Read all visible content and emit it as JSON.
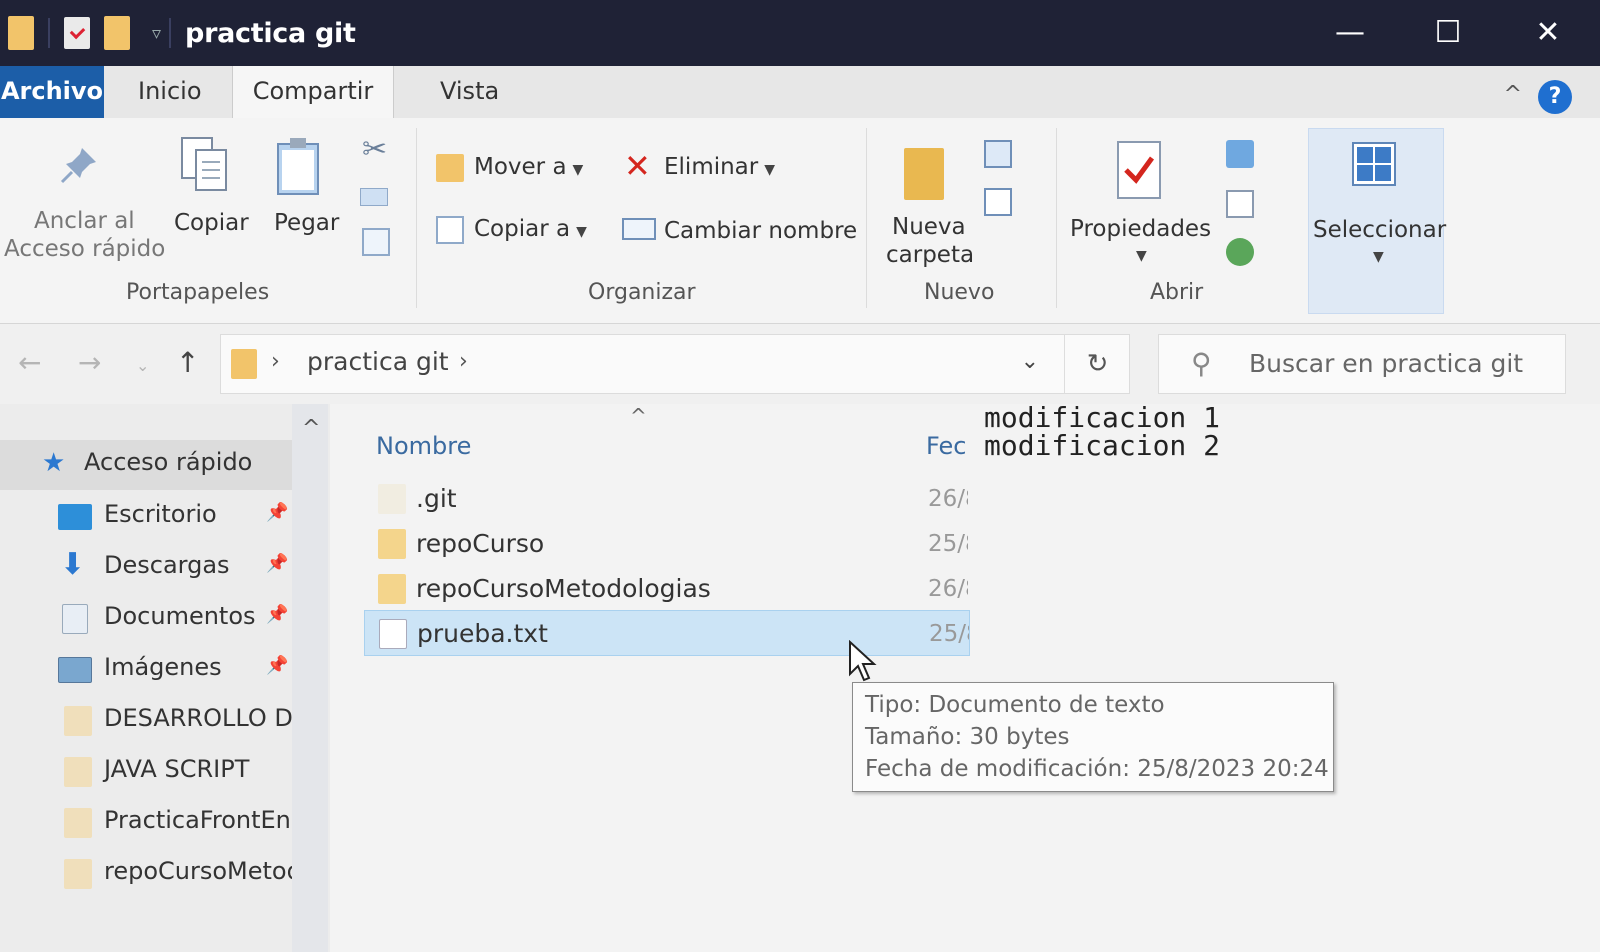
{
  "window": {
    "title": "practica git",
    "minimize": "—",
    "maximize": "☐",
    "close": "✕"
  },
  "ribbon_tabs": [
    "Archivo",
    "Inicio",
    "Compartir",
    "Vista"
  ],
  "ribbon": {
    "pin_label_line1": "Anclar al",
    "pin_label_line2": "Acceso rápido",
    "copy": "Copiar",
    "paste": "Pegar",
    "group_clipboard": "Portapapeles",
    "move_to": "Mover a",
    "copy_to": "Copiar a",
    "delete": "Eliminar",
    "rename": "Cambiar nombre",
    "group_organize": "Organizar",
    "new_folder_line1": "Nueva",
    "new_folder_line2": "carpeta",
    "group_new": "Nuevo",
    "properties": "Propiedades",
    "group_open": "Abrir",
    "select": "Seleccionar"
  },
  "address": {
    "path": "practica git",
    "search_placeholder": "Buscar en practica git"
  },
  "nav_pane": {
    "quick_access": "Acceso rápido",
    "items": [
      {
        "label": "Escritorio",
        "pinned": true
      },
      {
        "label": "Descargas",
        "pinned": true
      },
      {
        "label": "Documentos",
        "pinned": true
      },
      {
        "label": "Imágenes",
        "pinned": true
      },
      {
        "label": "DESARROLLO DE",
        "pinned": false
      },
      {
        "label": "JAVA SCRIPT",
        "pinned": false
      },
      {
        "label": "PracticaFrontEnd",
        "pinned": false
      },
      {
        "label": "repoCursoMetodologias",
        "pinned": false
      }
    ]
  },
  "file_list": {
    "col_name": "Nombre",
    "col_date": "Fec",
    "files": [
      {
        "name": ".git",
        "date": "26/8",
        "type": "git-folder"
      },
      {
        "name": "repoCurso",
        "date": "25/8",
        "type": "folder"
      },
      {
        "name": "repoCursoMetodologias",
        "date": "26/8",
        "type": "folder"
      },
      {
        "name": "prueba.txt",
        "date": "25/8",
        "type": "txt",
        "selected": true
      }
    ]
  },
  "preview_text": [
    "modificacion 1",
    "modificacion 2"
  ],
  "tooltip": {
    "type": "Tipo: Documento de texto",
    "size": "Tamaño: 30 bytes",
    "modified": "Fecha de modificación: 25/8/2023 20:24"
  },
  "colors": {
    "titlebar": "#1f2236",
    "file_tab": "#1c5ea8",
    "selection": "#cce4f6",
    "folder": "#f4d58c"
  }
}
